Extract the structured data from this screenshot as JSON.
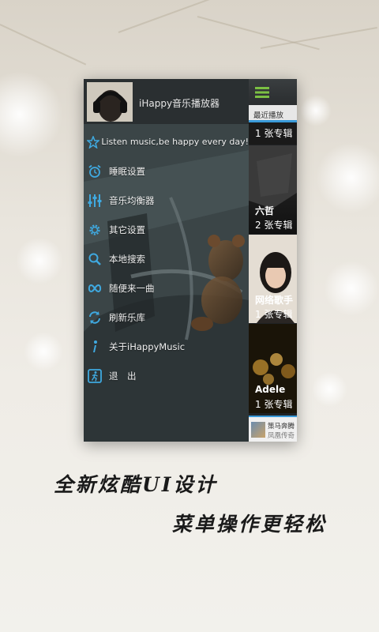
{
  "app": {
    "title": "iHappy音乐播放器"
  },
  "drawer": {
    "items": [
      {
        "label": "Listen music,be happy every day!",
        "icon": "star-icon"
      },
      {
        "label": "睡眠设置",
        "icon": "alarm-clock-icon"
      },
      {
        "label": "音乐均衡器",
        "icon": "equalizer-icon"
      },
      {
        "label": "其它设置",
        "icon": "gear-icon"
      },
      {
        "label": "本地搜索",
        "icon": "search-icon"
      },
      {
        "label": "随便来一曲",
        "icon": "shuffle-icon"
      },
      {
        "label": "刷新乐库",
        "icon": "refresh-icon"
      },
      {
        "label": "关于iHappyMusic",
        "icon": "info-icon"
      },
      {
        "label": "退　出",
        "icon": "exit-icon"
      }
    ]
  },
  "main": {
    "menu_icon": "hamburger-menu-icon",
    "tab": "最近播放",
    "cards": [
      {
        "name": "",
        "count": "1 张专辑"
      },
      {
        "name": "六哲",
        "count": "2 张专辑"
      },
      {
        "name": "网络歌手",
        "count": "1 张专辑"
      },
      {
        "name": "Adele",
        "count": "1 张专辑"
      }
    ],
    "now_playing": {
      "title": "策马奔腾",
      "artist": "凤凰传奇"
    }
  },
  "slogan": {
    "line1": "全新炫酷UI设计",
    "line2": "菜单操作更轻松"
  },
  "colors": {
    "accent": "#3a9ad9",
    "menu_icon_green": "#7bc043",
    "drawer_icon_blue": "#3fa9e0"
  }
}
